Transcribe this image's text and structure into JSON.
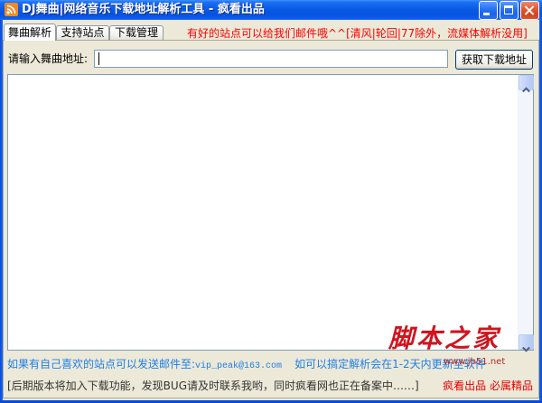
{
  "window": {
    "title": "DJ舞曲|网络音乐下载地址解析工具 - 疯看出品",
    "icon": "rss-icon",
    "controls": {
      "minimize": "minimize-icon",
      "maximize": "maximize-icon",
      "close": "close-icon"
    }
  },
  "tabs": [
    {
      "label": "舞曲解析",
      "selected": true
    },
    {
      "label": "支持站点",
      "selected": false
    },
    {
      "label": "下载管理",
      "selected": false
    }
  ],
  "notice": "有好的站点可以给我们邮件哦^^[清风|轮回|77除外，流媒体解析没用]",
  "url_form": {
    "label": "请输入舞曲地址:",
    "value": "",
    "button_label": "获取下载地址"
  },
  "result_box": {
    "value": "",
    "scrollbar_icons": {
      "up": "scroll-up-arrow-icon",
      "down": "scroll-down-arrow-icon"
    }
  },
  "contact": {
    "email_prompt": "如果有自己喜欢的站点可以发送邮件至:",
    "email": "vip_peak@163.com",
    "update_note": "如可以搞定解析会在1-2天内更新至软件"
  },
  "status": {
    "left": "[后期版本将加入下载功能，发现BUG请及时联系我哟，同时疯看网也正在备案中……]",
    "right": "疯看出品 必属精品"
  },
  "watermark": {
    "logo_text": "脚本之家",
    "url": "www.jb51.net"
  },
  "colors": {
    "title_bar": "#0A5BE6",
    "window_bg": "#ECE9D8",
    "notice": "#FF0000",
    "contact": "#1F7FE8",
    "status_left": "#333333",
    "status_right": "#E60000",
    "watermark": "#D0141E"
  }
}
